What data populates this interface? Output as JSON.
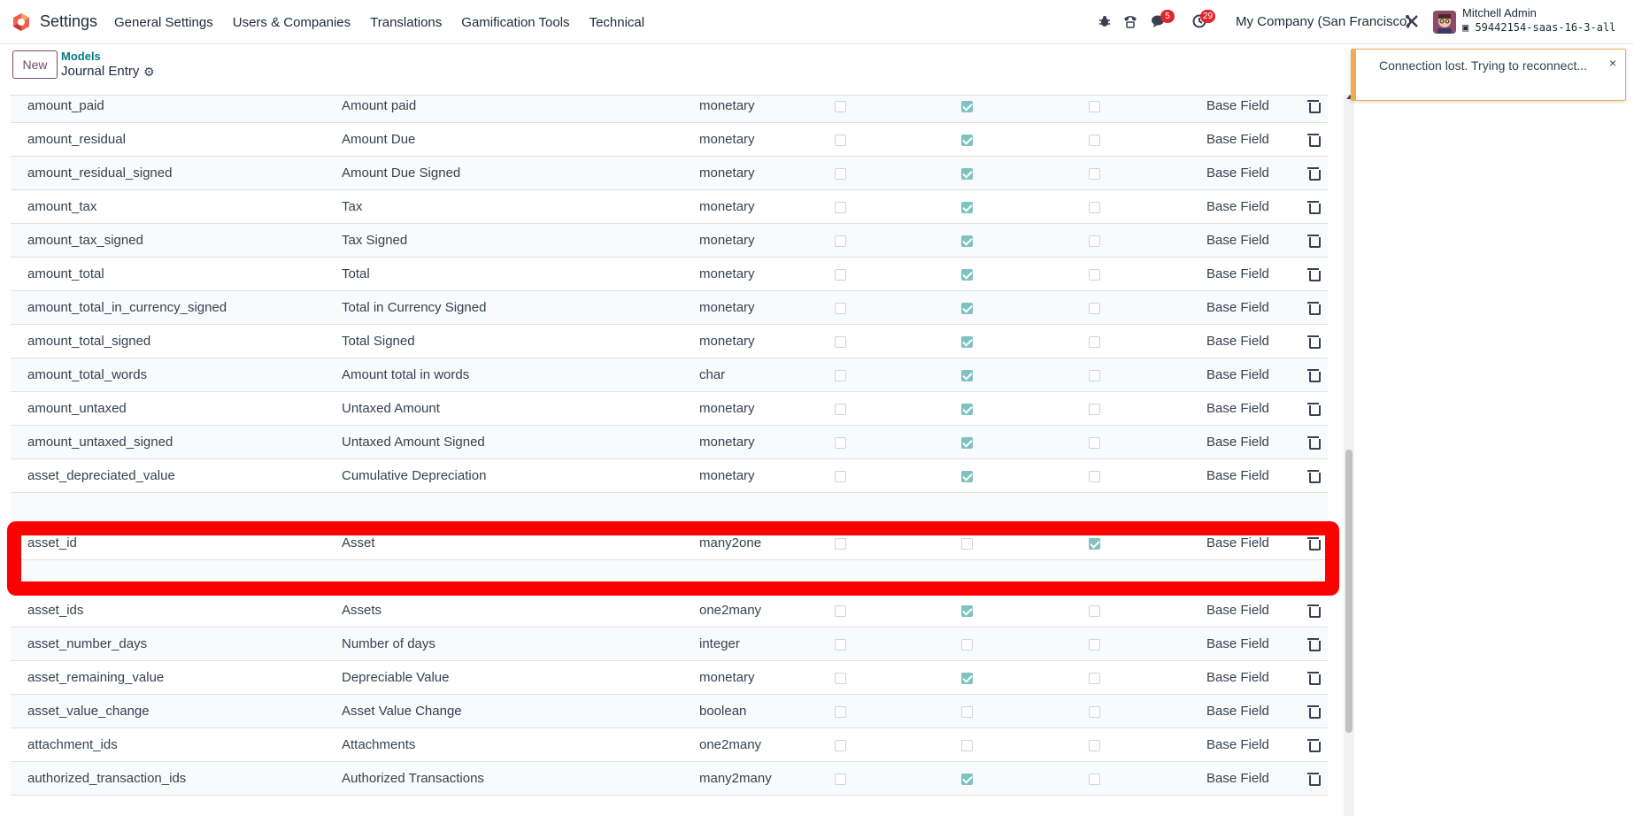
{
  "navbar": {
    "app_name": "Settings",
    "menu": [
      "General Settings",
      "Users & Companies",
      "Translations",
      "Gamification Tools",
      "Technical"
    ],
    "icons": [
      "bug-icon",
      "phone-icon",
      "chat-icon",
      "activity-icon",
      "tools-icon"
    ],
    "chat_badge": "5",
    "activity_badge": "29",
    "company": "My Company (San Francisco)",
    "user_name": "Mitchell Admin",
    "db_name": "59442154-saas-16-3-all"
  },
  "control": {
    "new_label": "New",
    "breadcrumb_parent": "Models",
    "breadcrumb_current": "Journal Entry"
  },
  "notification": {
    "message": "Connection lost. Trying to reconnect...",
    "close": "×"
  },
  "colors": {
    "highlight": "#ff0000",
    "checkbox_checked": "#7fc3c0",
    "brand": "#714b67",
    "warning": "#f0ad4e"
  },
  "table": {
    "rows": [
      {
        "name": "amount_paid",
        "label": "Amount paid",
        "type": "monetary",
        "c1": false,
        "c2": true,
        "c3": false,
        "source": "Base Field"
      },
      {
        "name": "amount_residual",
        "label": "Amount Due",
        "type": "monetary",
        "c1": false,
        "c2": true,
        "c3": false,
        "source": "Base Field"
      },
      {
        "name": "amount_residual_signed",
        "label": "Amount Due Signed",
        "type": "monetary",
        "c1": false,
        "c2": true,
        "c3": false,
        "source": "Base Field"
      },
      {
        "name": "amount_tax",
        "label": "Tax",
        "type": "monetary",
        "c1": false,
        "c2": true,
        "c3": false,
        "source": "Base Field"
      },
      {
        "name": "amount_tax_signed",
        "label": "Tax Signed",
        "type": "monetary",
        "c1": false,
        "c2": true,
        "c3": false,
        "source": "Base Field"
      },
      {
        "name": "amount_total",
        "label": "Total",
        "type": "monetary",
        "c1": false,
        "c2": true,
        "c3": false,
        "source": "Base Field"
      },
      {
        "name": "amount_total_in_currency_signed",
        "label": "Total in Currency Signed",
        "type": "monetary",
        "c1": false,
        "c2": true,
        "c3": false,
        "source": "Base Field"
      },
      {
        "name": "amount_total_signed",
        "label": "Total Signed",
        "type": "monetary",
        "c1": false,
        "c2": true,
        "c3": false,
        "source": "Base Field"
      },
      {
        "name": "amount_total_words",
        "label": "Amount total in words",
        "type": "char",
        "c1": false,
        "c2": true,
        "c3": false,
        "source": "Base Field"
      },
      {
        "name": "amount_untaxed",
        "label": "Untaxed Amount",
        "type": "monetary",
        "c1": false,
        "c2": true,
        "c3": false,
        "source": "Base Field"
      },
      {
        "name": "amount_untaxed_signed",
        "label": "Untaxed Amount Signed",
        "type": "monetary",
        "c1": false,
        "c2": true,
        "c3": false,
        "source": "Base Field"
      },
      {
        "name": "asset_depreciated_value",
        "label": "Cumulative Depreciation",
        "type": "monetary",
        "c1": false,
        "c2": true,
        "c3": false,
        "source": "Base Field"
      },
      {
        "name": "",
        "label": "",
        "type": "",
        "c1": false,
        "c2": false,
        "c3": false,
        "source": ""
      },
      {
        "name": "asset_id",
        "label": "Asset",
        "type": "many2one",
        "c1": false,
        "c2": false,
        "c3": true,
        "source": "Base Field"
      },
      {
        "name": "",
        "label": "",
        "type": "",
        "c1": false,
        "c2": false,
        "c3": false,
        "source": ""
      },
      {
        "name": "asset_ids",
        "label": "Assets",
        "type": "one2many",
        "c1": false,
        "c2": true,
        "c3": false,
        "source": "Base Field"
      },
      {
        "name": "asset_number_days",
        "label": "Number of days",
        "type": "integer",
        "c1": false,
        "c2": false,
        "c3": false,
        "source": "Base Field"
      },
      {
        "name": "asset_remaining_value",
        "label": "Depreciable Value",
        "type": "monetary",
        "c1": false,
        "c2": true,
        "c3": false,
        "source": "Base Field"
      },
      {
        "name": "asset_value_change",
        "label": "Asset Value Change",
        "type": "boolean",
        "c1": false,
        "c2": false,
        "c3": false,
        "source": "Base Field"
      },
      {
        "name": "attachment_ids",
        "label": "Attachments",
        "type": "one2many",
        "c1": false,
        "c2": false,
        "c3": false,
        "source": "Base Field"
      },
      {
        "name": "authorized_transaction_ids",
        "label": "Authorized Transactions",
        "type": "many2many",
        "c1": false,
        "c2": true,
        "c3": false,
        "source": "Base Field"
      }
    ]
  }
}
